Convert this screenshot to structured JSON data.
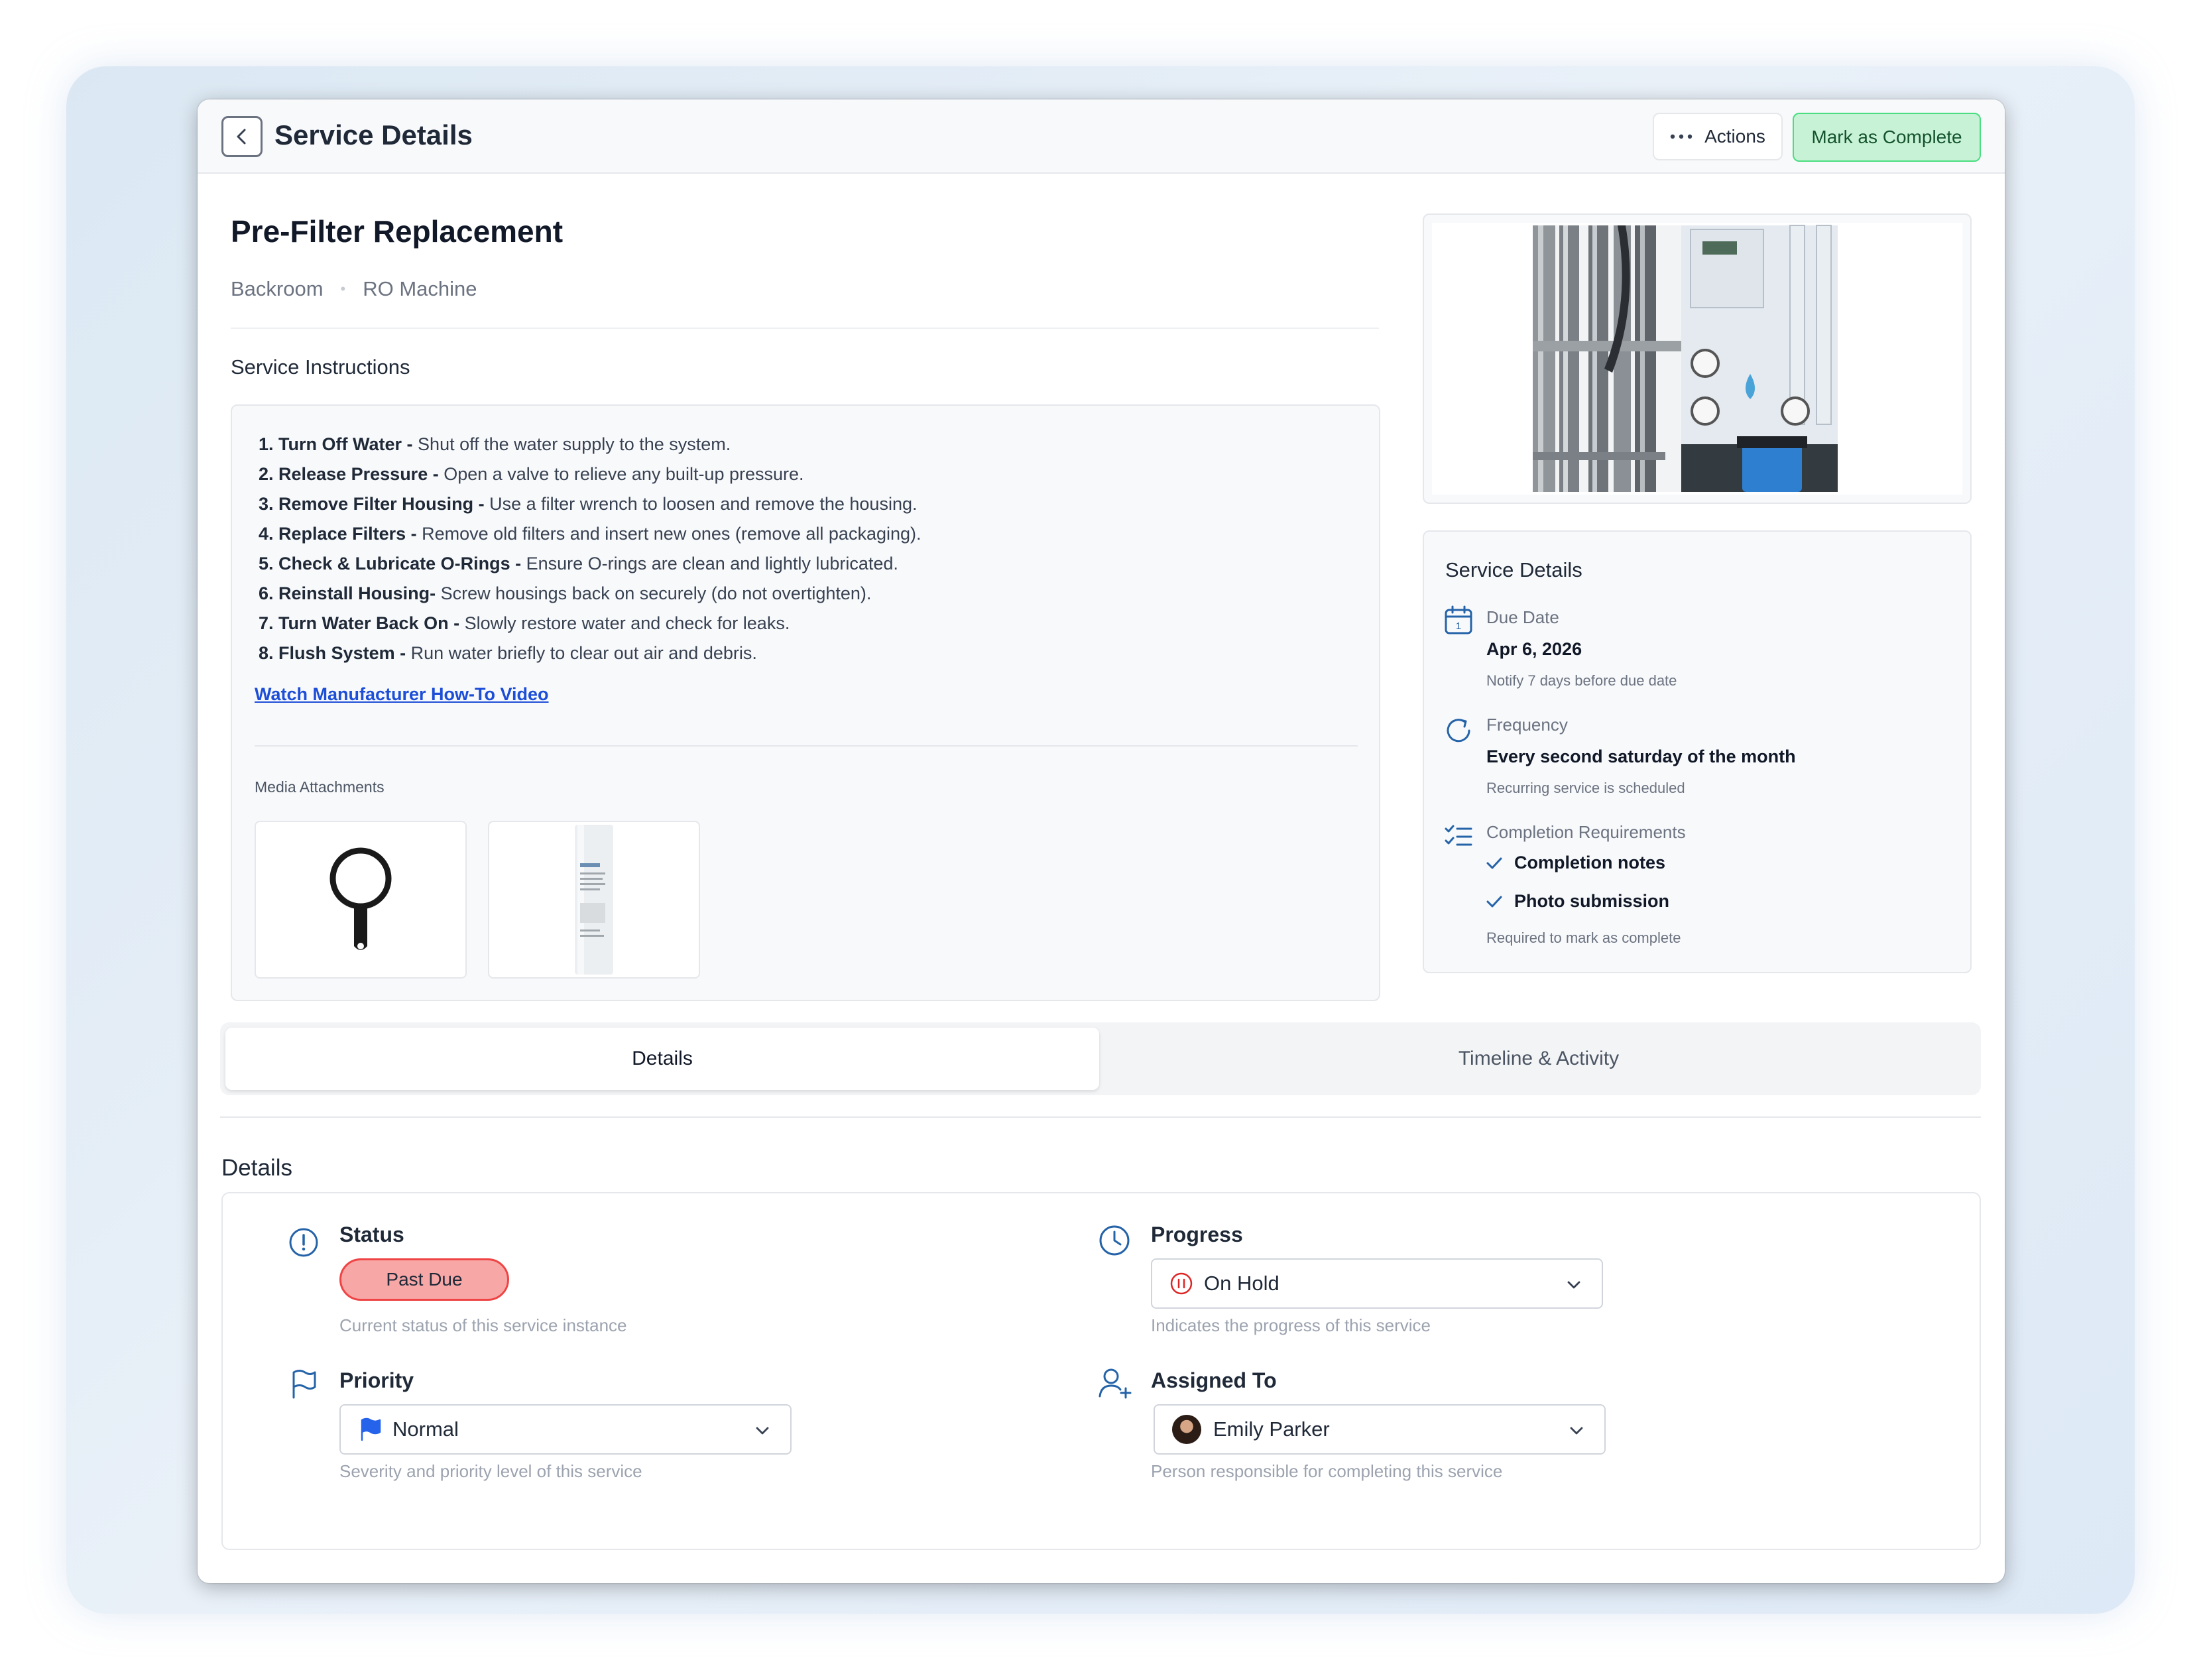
{
  "header": {
    "title": "Service Details",
    "actions_label": "Actions",
    "complete_label": "Mark as Complete"
  },
  "service": {
    "title": "Pre-Filter Replacement",
    "location": "Backroom",
    "equipment": "RO Machine"
  },
  "instructions": {
    "heading": "Service Instructions",
    "steps": [
      {
        "num": "1.",
        "title": "Turn Off Water -",
        "text": "Shut off the water supply to the system."
      },
      {
        "num": "2.",
        "title": "Release Pressure -",
        "text": "Open a valve to relieve any built-up pressure."
      },
      {
        "num": "3.",
        "title": "Remove Filter Housing -",
        "text": "Use a filter wrench to loosen and remove the housing."
      },
      {
        "num": "4.",
        "title": "Replace Filters -",
        "text": "Remove old filters and insert new ones (remove all packaging)."
      },
      {
        "num": "5.",
        "title": "Check & Lubricate O-Rings -",
        "text": "Ensure O-rings are clean and lightly lubricated."
      },
      {
        "num": "6.",
        "title": "Reinstall Housing-",
        "text": "Screw housings back on securely (do not overtighten)."
      },
      {
        "num": "7.",
        "title": "Turn Water Back On -",
        "text": "Slowly restore water and check for leaks."
      },
      {
        "num": "8.",
        "title": "Flush System -",
        "text": "Run water briefly to clear out air and debris."
      }
    ],
    "video_link": "Watch Manufacturer How-To Video",
    "media_label": "Media Attachments"
  },
  "service_details": {
    "heading": "Service Details",
    "due_date_label": "Due Date",
    "due_date": "Apr 6, 2026",
    "due_note": "Notify 7 days before due date",
    "frequency_label": "Frequency",
    "frequency": "Every second saturday of the month",
    "frequency_note": "Recurring service is scheduled",
    "requirements_label": "Completion Requirements",
    "requirements": [
      "Completion notes",
      "Photo submission"
    ],
    "requirements_note": "Required to mark as complete",
    "calendar_day": "1"
  },
  "tabs": {
    "details": "Details",
    "timeline": "Timeline & Activity"
  },
  "details": {
    "heading": "Details",
    "status_label": "Status",
    "status_value": "Past Due",
    "status_help": "Current status of this service instance",
    "progress_label": "Progress",
    "progress_value": "On Hold",
    "progress_help": "Indicates the progress of this service",
    "priority_label": "Priority",
    "priority_value": "Normal",
    "priority_help": "Severity and priority level of this service",
    "assigned_label": "Assigned To",
    "assigned_value": "Emily Parker",
    "assigned_help": "Person responsible for completing this service"
  },
  "colors": {
    "accent_blue": "#1d4ed8",
    "complete_green": "#c8f2d6",
    "past_due_red": "#f8a7a7",
    "icon_blue": "#2563a8"
  },
  "icons": {
    "back": "chevron-left-icon",
    "actions": "more-dots-icon",
    "due_date": "calendar-icon",
    "frequency": "refresh-icon",
    "requirements": "checklist-icon",
    "status": "alert-circle-icon",
    "progress": "clock-icon",
    "priority": "flag-icon",
    "assigned": "user-plus-icon"
  }
}
